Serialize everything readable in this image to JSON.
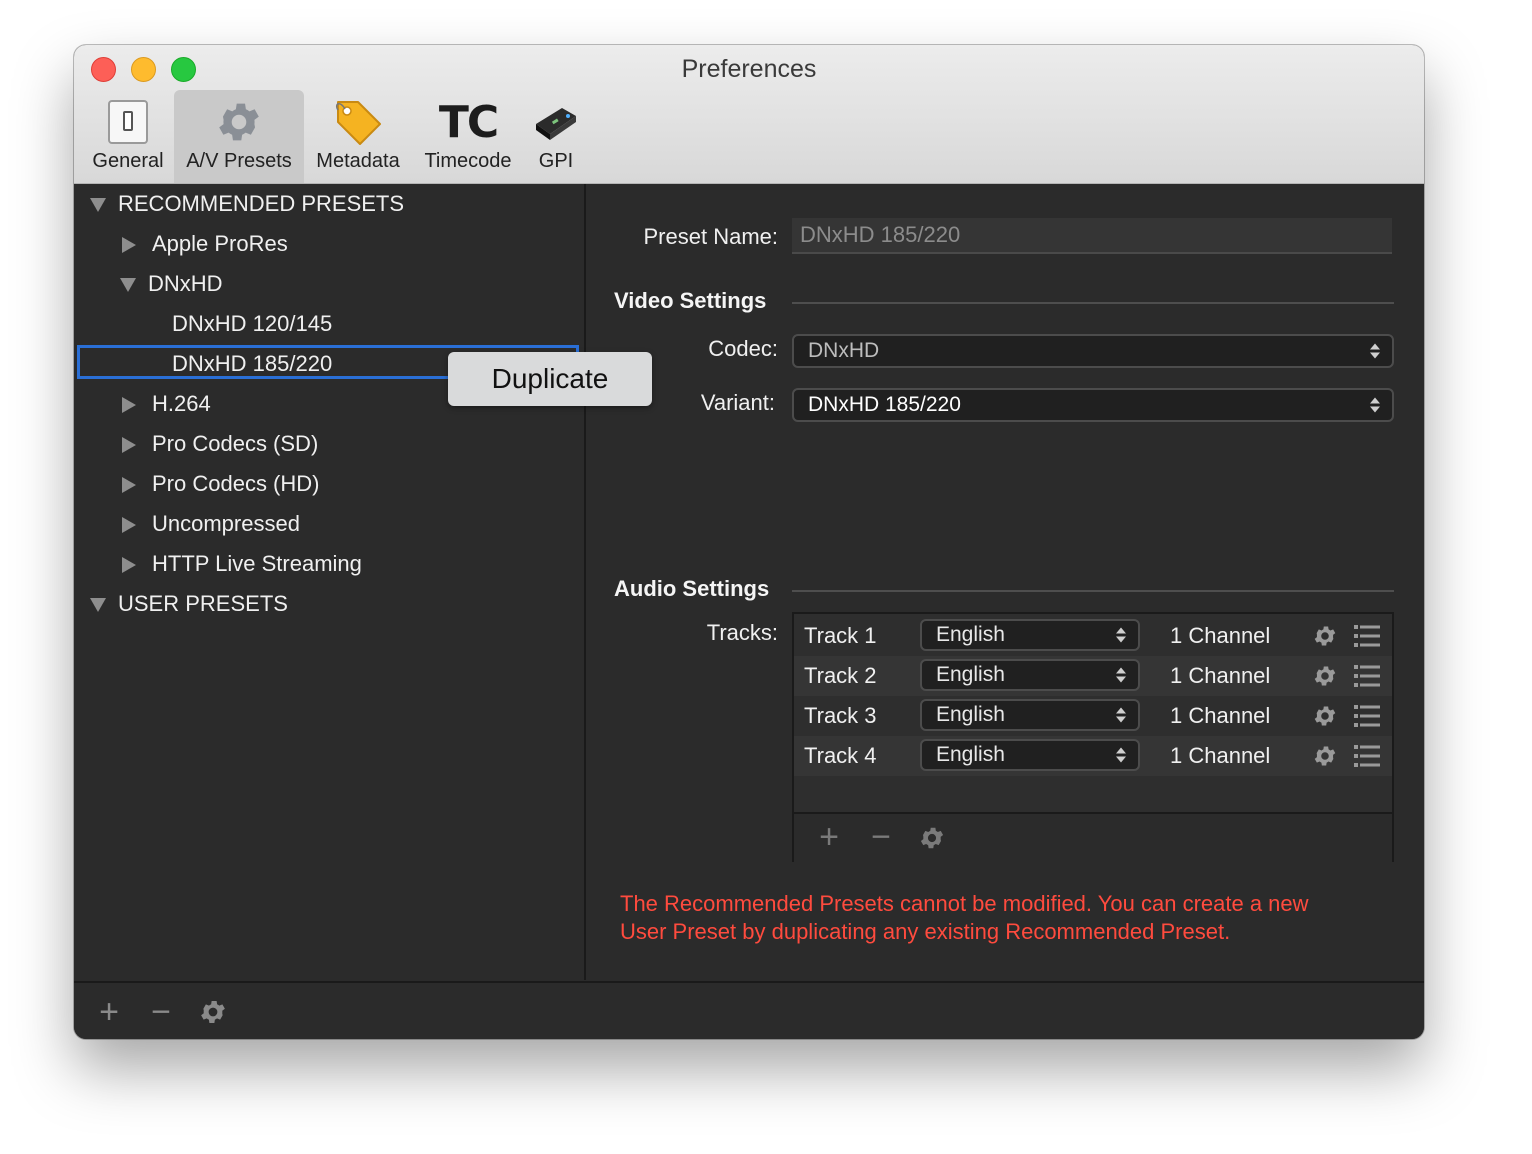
{
  "window": {
    "title": "Preferences"
  },
  "toolbar": {
    "items": [
      {
        "label": "General",
        "icon": "switch-icon",
        "selected": false
      },
      {
        "label": "A/V Presets",
        "icon": "gear-icon",
        "selected": true
      },
      {
        "label": "Metadata",
        "icon": "tag-icon",
        "selected": false
      },
      {
        "label": "Timecode",
        "icon": "tc-icon",
        "icon_text": "TC",
        "selected": false
      },
      {
        "label": "GPI",
        "icon": "gpi-box-icon",
        "selected": false
      }
    ]
  },
  "sidebar": {
    "recommended_header": "RECOMMENDED PRESETS",
    "groups": [
      {
        "label": "Apple ProRes"
      },
      {
        "label": "DNxHD",
        "children": [
          "DNxHD 120/145",
          "DNxHD 185/220"
        ]
      },
      {
        "label": "H.264"
      },
      {
        "label": "Pro Codecs (SD)"
      },
      {
        "label": "Pro Codecs (HD)"
      },
      {
        "label": "Uncompressed"
      },
      {
        "label": "HTTP Live Streaming"
      }
    ],
    "user_header": "USER PRESETS",
    "selected": "DNxHD 185/220"
  },
  "tooltip": {
    "label": "Duplicate"
  },
  "bottom_bar": {
    "add": "+",
    "remove": "−"
  },
  "preset": {
    "name_label": "Preset Name:",
    "name_value": "DNxHD 185/220",
    "video_settings_title": "Video Settings",
    "codec_label": "Codec:",
    "codec_value": "DNxHD",
    "variant_label": "Variant:",
    "variant_value": "DNxHD 185/220",
    "audio_settings_title": "Audio Settings",
    "tracks_label": "Tracks:",
    "tracks": [
      {
        "name": "Track 1",
        "language": "English",
        "channels": "1 Channel"
      },
      {
        "name": "Track 2",
        "language": "English",
        "channels": "1 Channel"
      },
      {
        "name": "Track 3",
        "language": "English",
        "channels": "1 Channel"
      },
      {
        "name": "Track 4",
        "language": "English",
        "channels": "1 Channel"
      }
    ],
    "tracks_footer": {
      "add": "+",
      "remove": "−"
    },
    "warning_line1": "The Recommended Presets cannot be modified. You can create a new",
    "warning_line2": "User Preset by duplicating any existing Recommended Preset."
  },
  "colors": {
    "accent": "#2a6fd6",
    "warning": "#ff4b3e"
  }
}
